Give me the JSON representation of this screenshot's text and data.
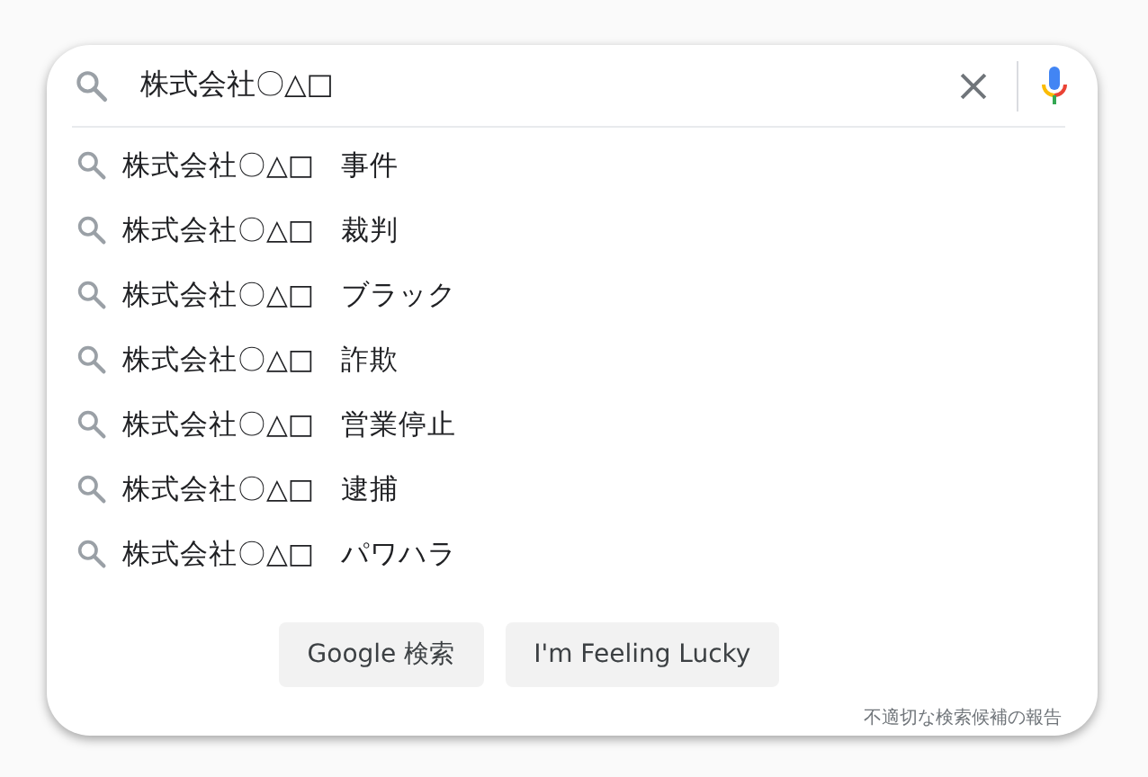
{
  "search": {
    "value": "株式会社〇△□"
  },
  "suggestions": [
    {
      "text": "株式会社〇△□ 事件"
    },
    {
      "text": "株式会社〇△□ 裁判"
    },
    {
      "text": "株式会社〇△□ ブラック"
    },
    {
      "text": "株式会社〇△□ 詐欺"
    },
    {
      "text": "株式会社〇△□ 営業停止"
    },
    {
      "text": "株式会社〇△□ 逮捕"
    },
    {
      "text": "株式会社〇△□ パワハラ"
    }
  ],
  "buttons": [
    "Google 検索",
    "I'm Feeling Lucky"
  ],
  "report_link": "不適切な検索候補の報告"
}
